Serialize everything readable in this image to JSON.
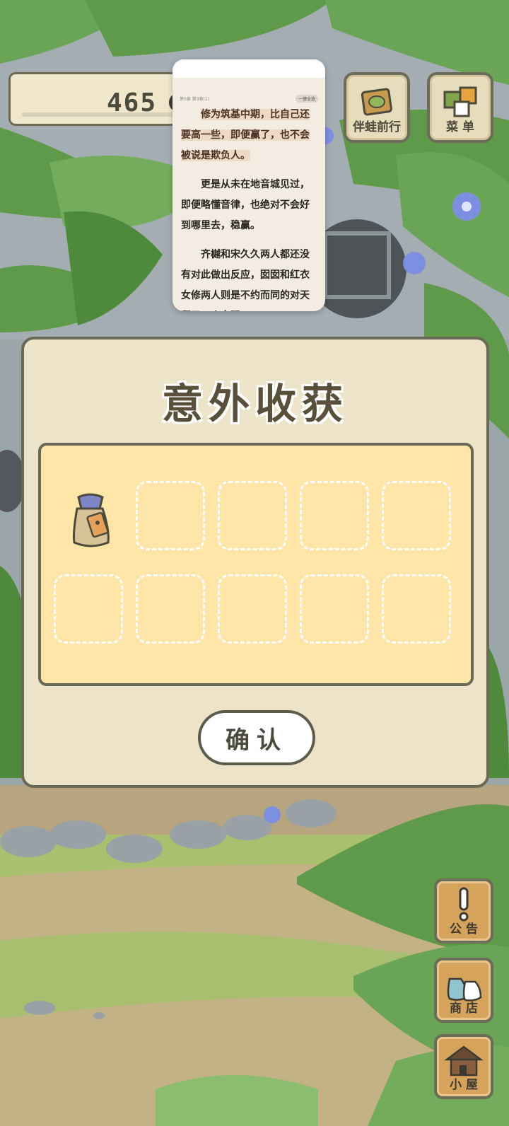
{
  "counter": {
    "value": "465"
  },
  "top_buttons": [
    {
      "label": "伴蛙前行",
      "icon": "journey-map-icon"
    },
    {
      "label": "菜 单",
      "icon": "menu-cards-icon"
    }
  ],
  "side_buttons": [
    {
      "label": "公 告",
      "icon": "exclamation-icon"
    },
    {
      "label": "商 店",
      "icon": "shop-bags-icon"
    },
    {
      "label": "小 屋",
      "icon": "house-icon"
    }
  ],
  "reader": {
    "chapter": "第5章 第3章(1)",
    "pill": "一键全选",
    "paragraphs": [
      "修为筑基中期，比自己还要高一些，即便赢了，也不会被说是欺负人。",
      "更是从未在地音城见过，即便略懂音律，也绝对不会好到哪里去，稳赢。",
      "齐樾和宋久久两人都还没有对此做出反应，囡囡和红衣女修两人则是不约而同的对天翻了一个白眼"
    ]
  },
  "dialog": {
    "title": "意外收获",
    "confirm_label": "确认",
    "slots": [
      {
        "item": "lucky-charm-bag"
      },
      {
        "item": null
      },
      {
        "item": null
      },
      {
        "item": null
      },
      {
        "item": null
      },
      {
        "item": null
      },
      {
        "item": null
      },
      {
        "item": null
      },
      {
        "item": null
      },
      {
        "item": null
      }
    ]
  },
  "colors": {
    "dialog_bg": "#ece3c8",
    "slot_panel_bg": "#ffe6a8",
    "border": "#6a6957",
    "leaf_green": "#5f9a4a"
  }
}
